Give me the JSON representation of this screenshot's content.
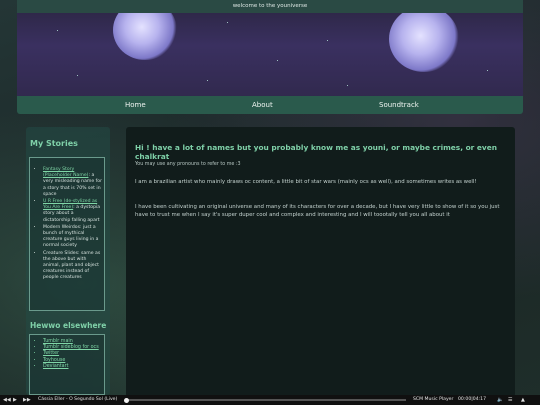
{
  "header": {
    "banner_text": "welcome to the youniverse"
  },
  "nav": {
    "items": [
      "Home",
      "About",
      "Soundtrack"
    ]
  },
  "sidebar": {
    "stories_title": "My Stories",
    "stories": [
      {
        "link": "Fantasy Story (Placeholder Name)",
        "text": ": a very misleading name for a story that is 70% set in space"
      },
      {
        "link": "U R Free (de-stylized as You Are Free)",
        "text": ": a dystopia story about a dictatorship falling apart"
      },
      {
        "link": "",
        "text": "Modern Weirdos: just a bunch of mythical creature guys living in a normal society"
      },
      {
        "link": "",
        "text": "Creature Slides: same as the above but with animal, plant and object creatures instead of people creatures"
      }
    ],
    "links_title": "Hewwo elsewhere",
    "links": [
      "Tumblr main",
      "Tumblr sideblog for ocs",
      "Twitter",
      "Toyhouse",
      "Deviantart"
    ]
  },
  "main": {
    "title": "Hi ! have a lot of names but you probably know me as youni, or maybe crimes, or even chalkrat",
    "pronouns": "You may use any pronouns to refer to me :3",
    "paragraph1": "I am a brazilian artist who mainly draws oc content, a little bit of star wars (mainly ocs as well), and sometimes writes as well!",
    "paragraph2": "I have been cultivating an original universe and many of its characters for over a decade, but I have very little to show of it so you just have to trust me when I say it's super duper cool and complex and interesting and I will toootally tell you all about it"
  },
  "player": {
    "track": "Cássia Eller - O Segundo Sol (Live)",
    "player_name": "SCM Music Player",
    "time": "00:00|04:17",
    "progress": 0.0
  }
}
